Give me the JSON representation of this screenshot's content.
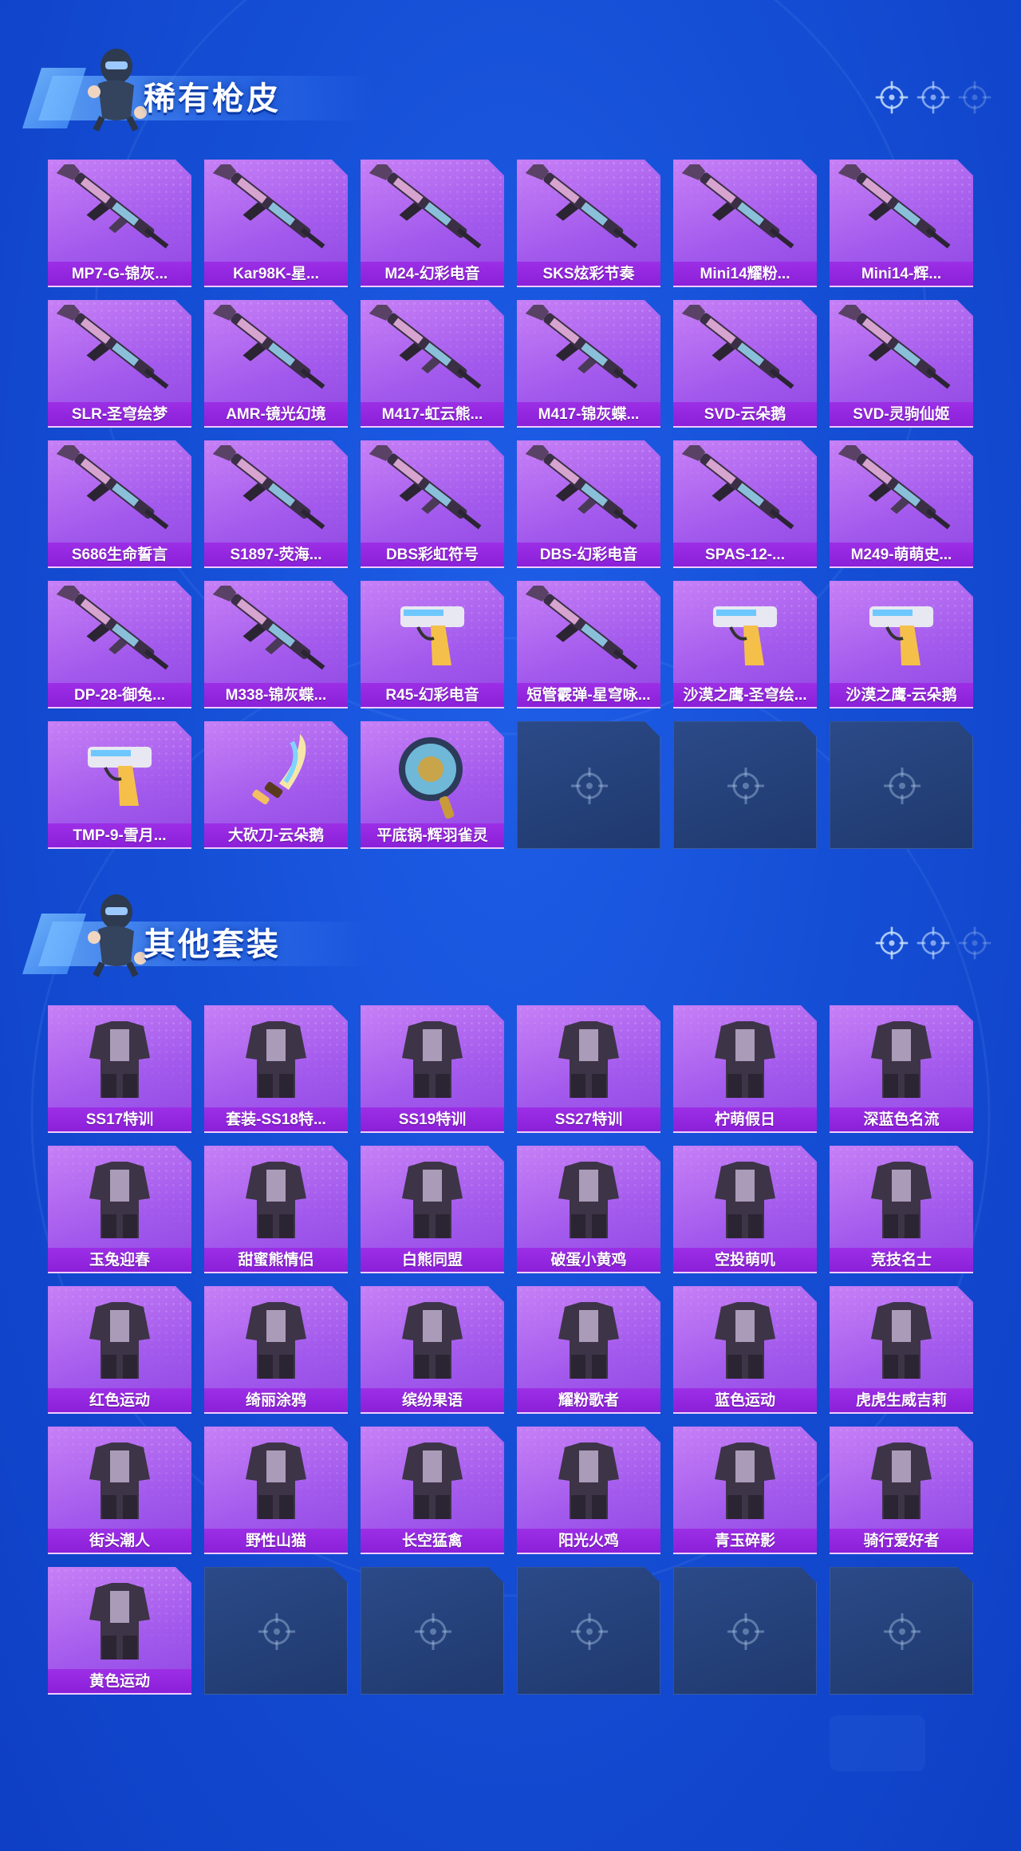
{
  "colors": {
    "background": "#1552d8",
    "tile": "#a158ec",
    "label_bar": "#8a1fd8",
    "empty_tile": "#243f78"
  },
  "sections": [
    {
      "title": "稀有枪皮",
      "items": [
        {
          "label": "MP7-G-锦灰...",
          "icon": "gun-icon"
        },
        {
          "label": "Kar98K-星...",
          "icon": "rifle-icon"
        },
        {
          "label": "M24-幻彩电音",
          "icon": "rifle-icon"
        },
        {
          "label": "SKS炫彩节奏",
          "icon": "rifle-icon"
        },
        {
          "label": "Mini14耀粉...",
          "icon": "rifle-icon"
        },
        {
          "label": "Mini14-辉...",
          "icon": "rifle-icon"
        },
        {
          "label": "SLR-圣穹绘梦",
          "icon": "rifle-icon"
        },
        {
          "label": "AMR-镜光幻境",
          "icon": "rifle-icon"
        },
        {
          "label": "M417-虹云熊...",
          "icon": "gun-icon"
        },
        {
          "label": "M417-锦灰蝶...",
          "icon": "gun-icon"
        },
        {
          "label": "SVD-云朵鹅",
          "icon": "rifle-icon"
        },
        {
          "label": "SVD-灵驹仙姬",
          "icon": "rifle-icon"
        },
        {
          "label": "S686生命誓言",
          "icon": "shotgun-icon"
        },
        {
          "label": "S1897-荧海...",
          "icon": "shotgun-icon"
        },
        {
          "label": "DBS彩虹符号",
          "icon": "gun-icon"
        },
        {
          "label": "DBS-幻彩电音",
          "icon": "gun-icon"
        },
        {
          "label": "SPAS-12-...",
          "icon": "shotgun-icon"
        },
        {
          "label": "M249-萌萌史...",
          "icon": "gun-icon"
        },
        {
          "label": "DP-28-御兔...",
          "icon": "gun-icon"
        },
        {
          "label": "M338-锦灰蝶...",
          "icon": "gun-icon"
        },
        {
          "label": "R45-幻彩电音",
          "icon": "pistol-icon"
        },
        {
          "label": "短管霰弹-星穹咏...",
          "icon": "shotgun-icon"
        },
        {
          "label": "沙漠之鹰-圣穹绘...",
          "icon": "pistol-icon"
        },
        {
          "label": "沙漠之鹰-云朵鹅",
          "icon": "pistol-icon"
        },
        {
          "label": "TMP-9-雪月...",
          "icon": "pistol-icon"
        },
        {
          "label": "大砍刀-云朵鹅",
          "icon": "machete-icon"
        },
        {
          "label": "平底锅-辉羽雀灵",
          "icon": "pan-icon"
        }
      ],
      "empty_slots": 3
    },
    {
      "title": "其他套装",
      "items": [
        {
          "label": "SS17特训",
          "icon": "outfit-icon"
        },
        {
          "label": "套装-SS18特...",
          "icon": "outfit-icon"
        },
        {
          "label": "SS19特训",
          "icon": "outfit-icon"
        },
        {
          "label": "SS27特训",
          "icon": "outfit-icon"
        },
        {
          "label": "柠萌假日",
          "icon": "outfit-icon"
        },
        {
          "label": "深蓝色名流",
          "icon": "outfit-icon"
        },
        {
          "label": "玉兔迎春",
          "icon": "outfit-icon"
        },
        {
          "label": "甜蜜熊情侣",
          "icon": "outfit-icon"
        },
        {
          "label": "白熊同盟",
          "icon": "outfit-icon"
        },
        {
          "label": "破蛋小黄鸡",
          "icon": "outfit-icon"
        },
        {
          "label": "空投萌叽",
          "icon": "outfit-icon"
        },
        {
          "label": "竞技名士",
          "icon": "outfit-icon"
        },
        {
          "label": "红色运动",
          "icon": "outfit-icon"
        },
        {
          "label": "绮丽涂鸦",
          "icon": "outfit-icon"
        },
        {
          "label": "缤纷果语",
          "icon": "outfit-icon"
        },
        {
          "label": "耀粉歌者",
          "icon": "outfit-icon"
        },
        {
          "label": "蓝色运动",
          "icon": "outfit-icon"
        },
        {
          "label": "虎虎生威吉莉",
          "icon": "outfit-icon"
        },
        {
          "label": "街头潮人",
          "icon": "outfit-icon"
        },
        {
          "label": "野性山猫",
          "icon": "outfit-icon"
        },
        {
          "label": "长空猛禽",
          "icon": "outfit-icon"
        },
        {
          "label": "阳光火鸡",
          "icon": "outfit-icon"
        },
        {
          "label": "青玉碎影",
          "icon": "outfit-icon"
        },
        {
          "label": "骑行爱好者",
          "icon": "outfit-icon"
        },
        {
          "label": "黄色运动",
          "icon": "outfit-icon"
        }
      ],
      "empty_slots": 5
    }
  ]
}
